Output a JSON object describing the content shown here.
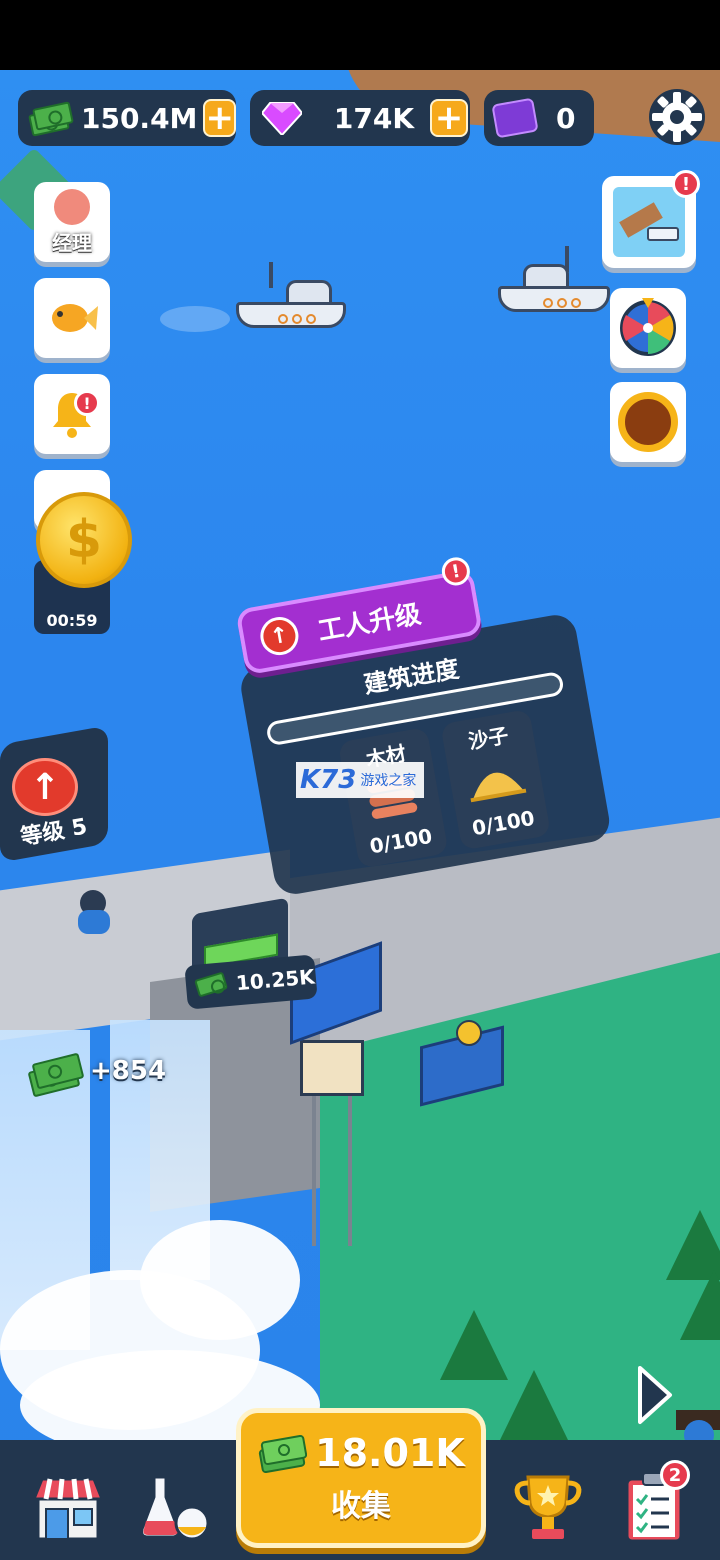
{
  "hud": {
    "cash": "150.4M",
    "gems": "174K",
    "tickets": "0"
  },
  "side_left": {
    "manager_label": "经理",
    "timer": "00:59"
  },
  "notifications": {
    "shop_badge_right": "!",
    "upgrade_badge": "!",
    "tasks_badge": "2"
  },
  "level": {
    "label": "等级 5"
  },
  "build": {
    "upgrade_label": "工人升级",
    "progress_title": "建筑进度",
    "progress": 0,
    "resources": [
      {
        "name": "木材",
        "amount": "0/100"
      },
      {
        "name": "沙子",
        "amount": "0/100"
      }
    ]
  },
  "world": {
    "rate_tag": "10.25K",
    "income_popup": "+854"
  },
  "collect": {
    "amount": "18.01K",
    "label": "收集"
  },
  "watermark": {
    "brand": "K73",
    "sub": "游戏之家"
  },
  "colors": {
    "water": "#2f8ff2",
    "panel": "#22364e",
    "accent_orange": "#f6b418",
    "upgrade_purple": "#a32fd0",
    "grass": "#2fb383"
  }
}
